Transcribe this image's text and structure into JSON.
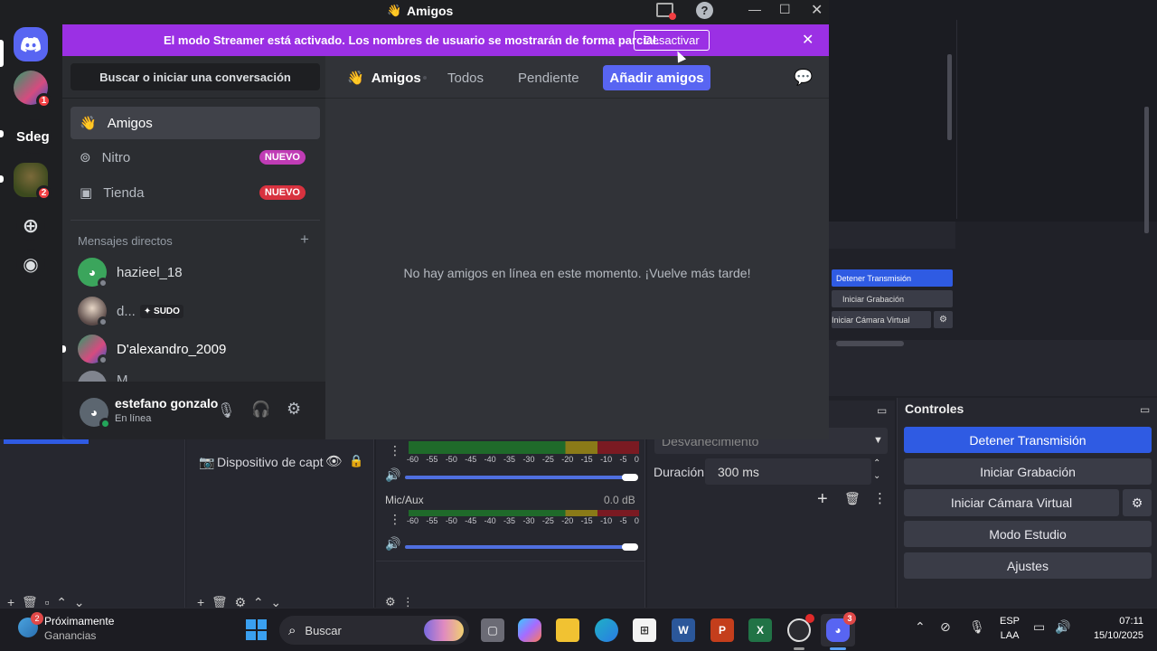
{
  "discord": {
    "window_title": "Amigos",
    "banner": {
      "text": "El modo Streamer está activado. Los nombres de usuario se mostrarán de forma parcial.",
      "button": "Desactivar"
    },
    "guilds": [
      {
        "badge": "1"
      },
      {
        "label": "Sdeg"
      },
      {
        "badge": "2"
      }
    ],
    "search_placeholder": "Buscar o iniciar una conversación",
    "nav": [
      {
        "label": "Amigos"
      },
      {
        "label": "Nitro",
        "badge": "NUEVO"
      },
      {
        "label": "Tienda",
        "badge": "NUEVO"
      }
    ],
    "dm_header": "Mensajes directos",
    "dms": [
      {
        "name": "hazieel_18"
      },
      {
        "name": "d...",
        "tag": "SUDO"
      },
      {
        "name": "D'alexandro_2009"
      },
      {
        "name": "M..."
      }
    ],
    "user": {
      "name": "estefano gonzalo",
      "status": "En línea"
    },
    "tabs": {
      "title": "Amigos",
      "todos": "Todos",
      "pendiente": "Pendiente",
      "add": "Añadir amigos"
    },
    "empty_text": "No hay amigos en línea en este momento. ¡Vuelve más tarde!"
  },
  "obs": {
    "mini_controls": [
      "Detener Transmisión",
      "Iniciar Grabación",
      "Iniciar Cámara Virtual"
    ],
    "source_label": "Dispositivo de captu",
    "mixer": {
      "ticks": [
        "-60",
        "-55",
        "-50",
        "-45",
        "-40",
        "-35",
        "-30",
        "-25",
        "-20",
        "-15",
        "-10",
        "-5",
        "0"
      ],
      "mic_label": "Mic/Aux",
      "mic_db": "0.0 dB"
    },
    "transition": {
      "type": "Desvanecimiento",
      "duration_label": "Duración",
      "duration_value": "300 ms"
    },
    "controls": {
      "title": "Controles",
      "buttons": [
        "Detener Transmisión",
        "Iniciar Grabación",
        "Iniciar Cámara Virtual",
        "Modo Estudio",
        "Ajustes"
      ]
    }
  },
  "taskbar": {
    "weather_badge": "2",
    "weather_title": "Próximamente",
    "weather_sub": "Ganancias",
    "search": "Buscar",
    "discord_badge": "3",
    "lang_top": "ESP",
    "lang_bottom": "LAA",
    "time": "07:11",
    "date": "15/10/2025"
  },
  "colors": {
    "accent": "#5865f2",
    "banner": "#9b30e4",
    "obs_active": "#2f5be3"
  }
}
